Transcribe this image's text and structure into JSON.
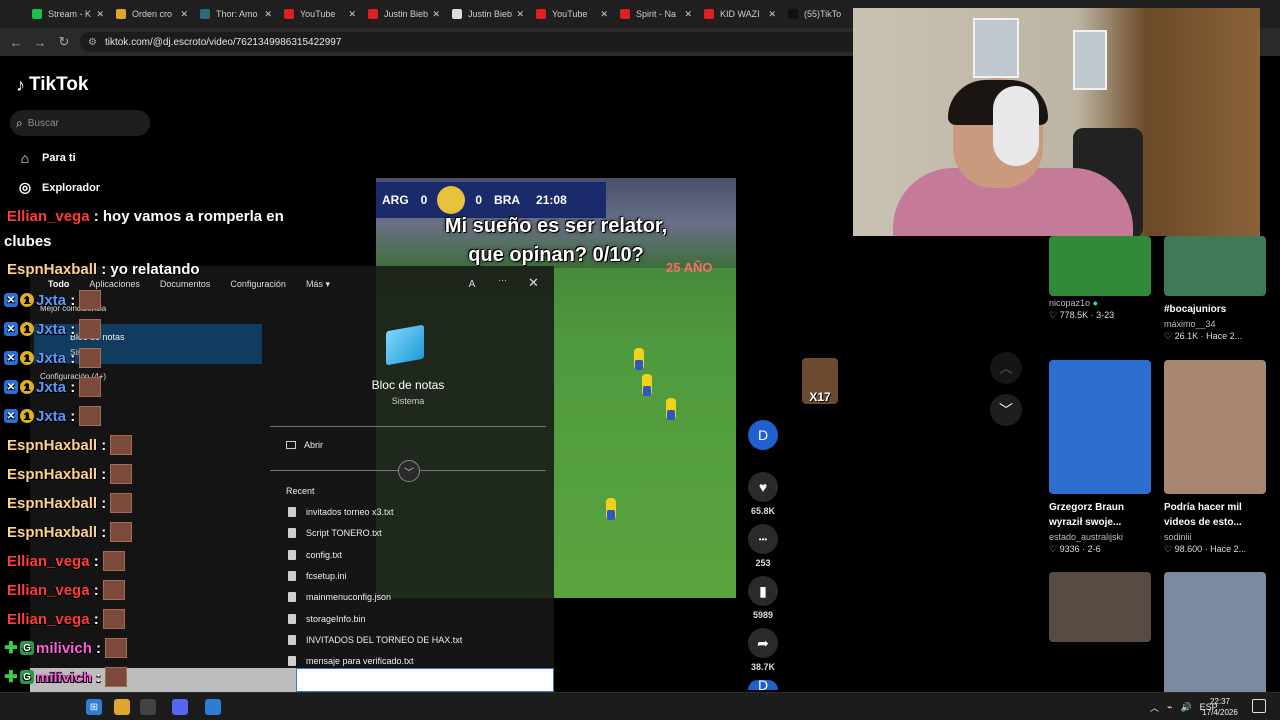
{
  "browser": {
    "tabs": [
      {
        "label": "Stream - K",
        "icon": "stream-favicon",
        "color": "#19c34a"
      },
      {
        "label": "Orden cro",
        "icon": "folder-favicon",
        "color": "#e0a52a"
      },
      {
        "label": "Thor: Amo",
        "icon": "thor-favicon",
        "color": "#2a6b7a"
      },
      {
        "label": "YouTube",
        "icon": "youtube-favicon",
        "color": "#e02020"
      },
      {
        "label": "Justin Bieb",
        "icon": "youtube-favicon",
        "color": "#e02020"
      },
      {
        "label": "Justin Bieb",
        "icon": "web-favicon",
        "color": "#dddddd"
      },
      {
        "label": "YouTube",
        "icon": "youtube-favicon",
        "color": "#e02020"
      },
      {
        "label": "Spirit - Na",
        "icon": "youtube-favicon",
        "color": "#e02020"
      },
      {
        "label": "KID WAZI",
        "icon": "youtube-favicon",
        "color": "#e02020"
      },
      {
        "label": "(55)TikTo",
        "icon": "tiktok-favicon",
        "color": "#111111"
      }
    ],
    "url": "tiktok.com/@dj.escroto/video/7621349986315422997"
  },
  "tiktok": {
    "logo": "TikTok",
    "search_placeholder": "Buscar",
    "nav": [
      {
        "label": "Para ti",
        "icon": "home-icon"
      },
      {
        "label": "Explorador",
        "icon": "compass-icon"
      }
    ],
    "video": {
      "team_left": "ARG",
      "score_left": "0",
      "score_right": "0",
      "team_right": "BRA",
      "match_time": "21:08",
      "caption_line1": "Mi sueño es ser relator,",
      "caption_line2": "que opinan? 0/10?",
      "banner": "25 AÑO"
    },
    "actions": [
      {
        "name": "profile",
        "icon": "profile-icon",
        "label": "D",
        "count": ""
      },
      {
        "name": "like",
        "icon": "heart-icon",
        "label": "♥",
        "count": "65.8K"
      },
      {
        "name": "comment",
        "icon": "comment-icon",
        "label": "•••",
        "count": "253"
      },
      {
        "name": "save",
        "icon": "bookmark-icon",
        "label": "▮",
        "count": "5989"
      },
      {
        "name": "share",
        "icon": "share-icon",
        "label": "➦",
        "count": "38.7K"
      }
    ],
    "sticker": "X17",
    "grid": [
      {
        "title": "",
        "author": "nicopaz1o",
        "verified": true,
        "likes": "778.5K",
        "date": "3-23",
        "color": "#2f8a3a"
      },
      {
        "title": "#bocajuniors",
        "author": "máximo__34",
        "verified": false,
        "likes": "26.1K",
        "date": "Hace 2...",
        "color": "#3d7a55"
      },
      {
        "title": "Grzegorz Braun wyraził swoje...",
        "author": "estado_australijski",
        "verified": false,
        "likes": "9336",
        "date": "2-6",
        "color": "#2d6fd0"
      },
      {
        "title": "Podría hacer mil videos de esto...",
        "author": "sodiniii",
        "verified": false,
        "likes": "98.600",
        "date": "Hace 2...",
        "color": "#a88770"
      },
      {
        "title": "",
        "author": "",
        "verified": false,
        "likes": "",
        "date": "",
        "color": "#5a4a44"
      },
      {
        "title": "",
        "author": "",
        "verified": false,
        "likes": "",
        "date": "",
        "color": "#7a8aa0"
      }
    ]
  },
  "chat": [
    {
      "user": "Ellian_vega",
      "msg": "hoy vamos a romperla en",
      "color": "#ff3b3b",
      "badge": ""
    },
    {
      "user": "",
      "msg": "clubes",
      "color": "#ffffff",
      "badge": ""
    },
    {
      "user": "EspnHaxball",
      "msg": "yo relatando",
      "color": "#ffd28a",
      "badge": ""
    },
    {
      "user": "Jxta",
      "msg": "",
      "color": "#5b9bff",
      "badge": "1"
    },
    {
      "user": "Jxta",
      "msg": "",
      "color": "#5b9bff",
      "badge": "1"
    },
    {
      "user": "Jxta",
      "msg": "",
      "color": "#5b9bff",
      "badge": "1"
    },
    {
      "user": "Jxta",
      "msg": "",
      "color": "#5b9bff",
      "badge": "1"
    },
    {
      "user": "Jxta",
      "msg": "",
      "color": "#5b9bff",
      "badge": "1"
    },
    {
      "user": "EspnHaxball",
      "msg": "",
      "color": "#ffd28a",
      "badge": ""
    },
    {
      "user": "EspnHaxball",
      "msg": "",
      "color": "#ffd28a",
      "badge": ""
    },
    {
      "user": "EspnHaxball",
      "msg": "",
      "color": "#ffd28a",
      "badge": ""
    },
    {
      "user": "EspnHaxball",
      "msg": "",
      "color": "#ffd28a",
      "badge": ""
    },
    {
      "user": "Ellian_vega",
      "msg": "",
      "color": "#ff3b3b",
      "badge": ""
    },
    {
      "user": "Ellian_vega",
      "msg": "",
      "color": "#ff3b3b",
      "badge": ""
    },
    {
      "user": "Ellian_vega",
      "msg": "",
      "color": "#ff3b3b",
      "badge": ""
    },
    {
      "user": "milivich",
      "msg": "",
      "color": "#ff5fd7",
      "badge": "G"
    },
    {
      "user": "milivich",
      "msg": "",
      "color": "#ff5fd7",
      "badge": "G"
    },
    {
      "user": "milivich",
      "msg": "",
      "color": "#ff5fd7",
      "badge": "G"
    }
  ],
  "start_panel": {
    "tabs": [
      "Todo",
      "Aplicaciones",
      "Documentos",
      "Configuración",
      "Más ▾"
    ],
    "avatar": "A",
    "more": "···",
    "close": "✕",
    "best_match": "Mejor coincidencia",
    "best_item": "Bloc de notas",
    "best_item_sub": "Sistema",
    "settings_group": "Configuración (4+)",
    "app_name": "Bloc de notas",
    "app_sub": "Sistema",
    "open_label": "Abrir",
    "recent_label": "Recent",
    "recent_files": [
      "invitados torneo x3.txt",
      "Script TONERO.txt",
      "config.txt",
      "fcsetup.ini",
      "mainmenuconfig.json",
      "storageInfo.bin",
      "INVITADOS DEL TORNEO DE HAX.txt",
      "mensaje para verificado.txt"
    ]
  },
  "taskbar": {
    "apps": [
      {
        "name": "files",
        "icon": "file-explorer-icon",
        "color": "#e0a52a"
      },
      {
        "name": "chrome",
        "icon": "chrome-icon",
        "color": "#444444"
      },
      {
        "name": "discord",
        "icon": "discord-icon",
        "color": "#5865f2"
      },
      {
        "name": "monitor",
        "icon": "monitor-icon",
        "color": "#2a7fd4"
      }
    ],
    "lang": "ESP",
    "time": "22:37",
    "date": "17/4/2026"
  }
}
